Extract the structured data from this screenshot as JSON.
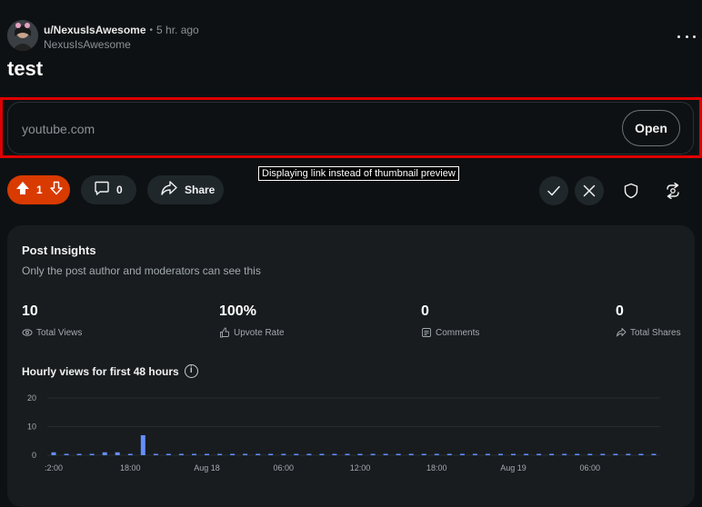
{
  "post": {
    "author": "u/NexusIsAwesome",
    "separator": "•",
    "time": "5 hr. ago",
    "subtitle": "NexusIsAwesome",
    "title": "test"
  },
  "link": {
    "domain": "youtube.com",
    "open_label": "Open",
    "tooltip": "Displaying link instead of thumbnail preview"
  },
  "actions": {
    "votes": "1",
    "comments": "0",
    "share_label": "Share"
  },
  "insights": {
    "title": "Post Insights",
    "subtitle": "Only the post author and moderators can see this",
    "stats": [
      {
        "value": "10",
        "label": "Total Views"
      },
      {
        "value": "100%",
        "label": "Upvote Rate"
      },
      {
        "value": "0",
        "label": "Comments"
      },
      {
        "value": "0",
        "label": "Total Shares"
      }
    ],
    "chart_title": "Hourly views for first 48 hours",
    "info_glyph": "i"
  },
  "colors": {
    "accent": "#d93a00",
    "bar": "#648efc",
    "highlight": "#e00000"
  },
  "chart_data": {
    "type": "bar",
    "title": "Hourly views for first 48 hours",
    "xlabel": "",
    "ylabel": "",
    "ylim": [
      0,
      20
    ],
    "yticks": [
      "0",
      "10",
      "20"
    ],
    "xticks": [
      ":2:00",
      "18:00",
      "Aug 18",
      "06:00",
      "12:00",
      "18:00",
      "Aug 19",
      "06:00"
    ],
    "values": [
      1,
      0,
      0,
      0,
      1,
      1,
      0,
      7,
      0,
      0,
      0,
      0,
      0,
      0,
      0,
      0,
      0,
      0,
      0,
      0,
      0,
      0,
      0,
      0,
      0,
      0,
      0,
      0,
      0,
      0,
      0,
      0,
      0,
      0,
      0,
      0,
      0,
      0,
      0,
      0,
      0,
      0,
      0,
      0,
      0,
      0,
      0,
      0
    ],
    "grid": true
  }
}
